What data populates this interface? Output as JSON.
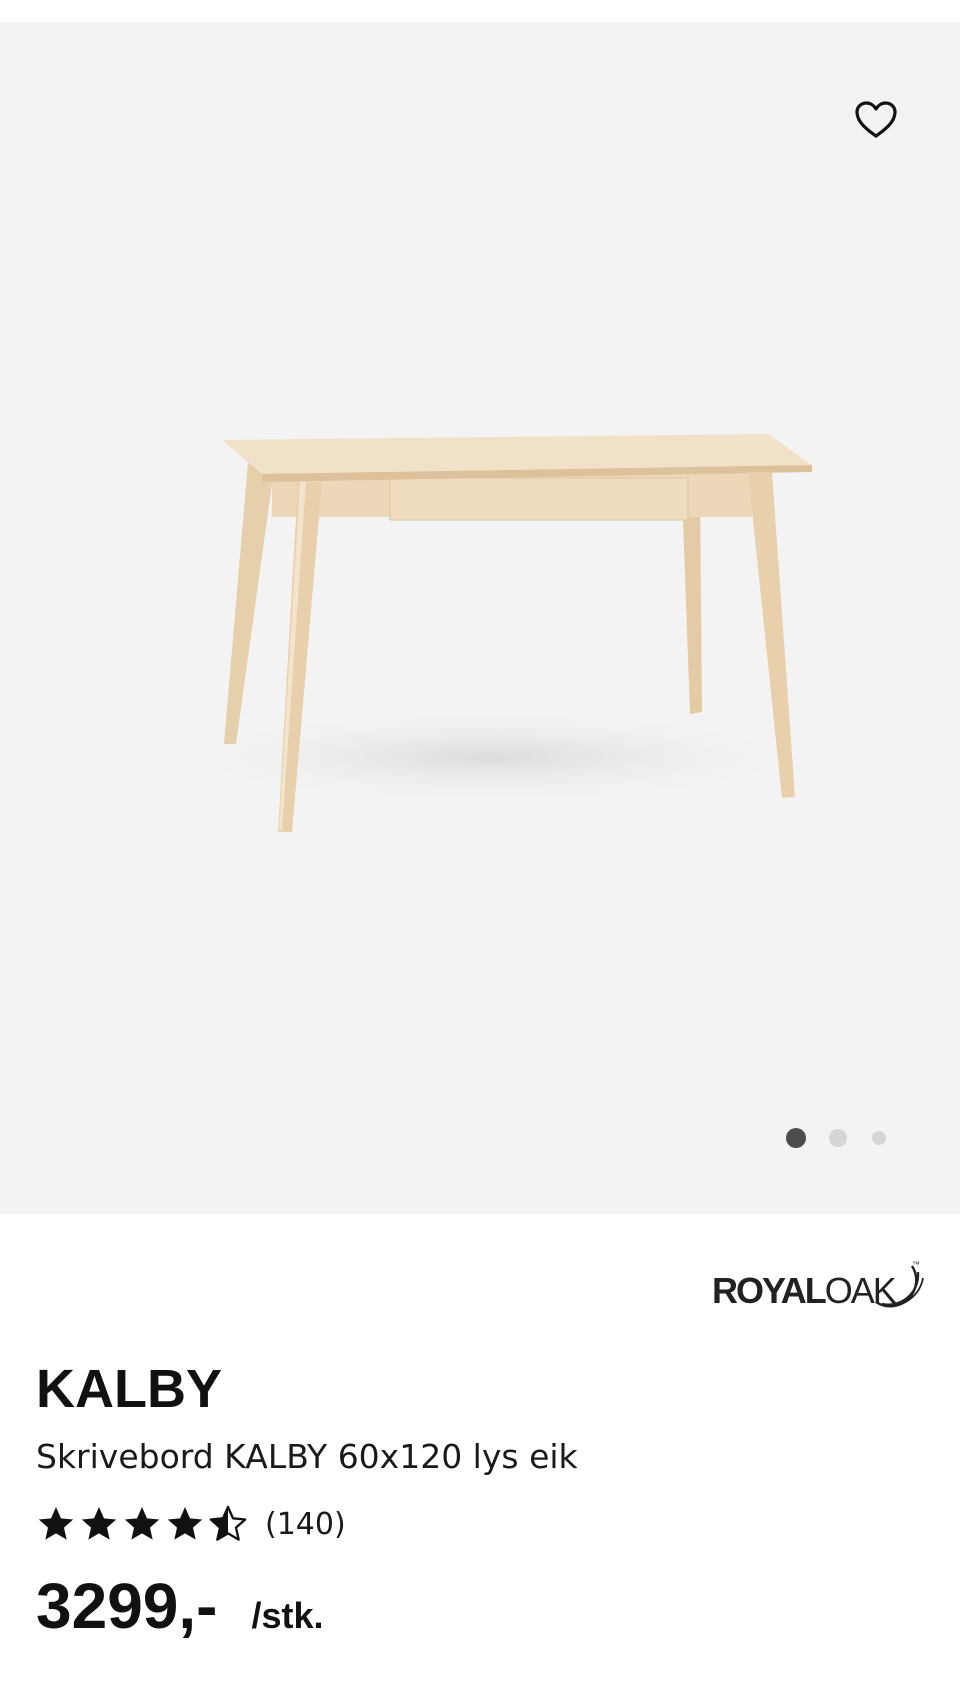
{
  "gallery": {
    "image": "kalby-desk-light-oak",
    "favorite_icon": "heart-outline-icon",
    "carousel": {
      "slide_count": 3,
      "active_slide": 1
    },
    "background_color": "#f4f3f4"
  },
  "brand": {
    "logo_text_bold": "ROYAL",
    "logo_text_light": "OAK",
    "trademark": "™"
  },
  "product": {
    "name": "KALBY",
    "description": "Skrivebord KALBY 60x120 lys eik",
    "rating": {
      "value": 4.5,
      "max": 5,
      "count_label": "(140)"
    },
    "price": "3299,-",
    "unit": "/stk."
  },
  "colors": {
    "text": "#111111",
    "dot_active": "#4d4d4d",
    "dot_inactive": "#d6d6d6",
    "wood": "#e8d2b0"
  }
}
